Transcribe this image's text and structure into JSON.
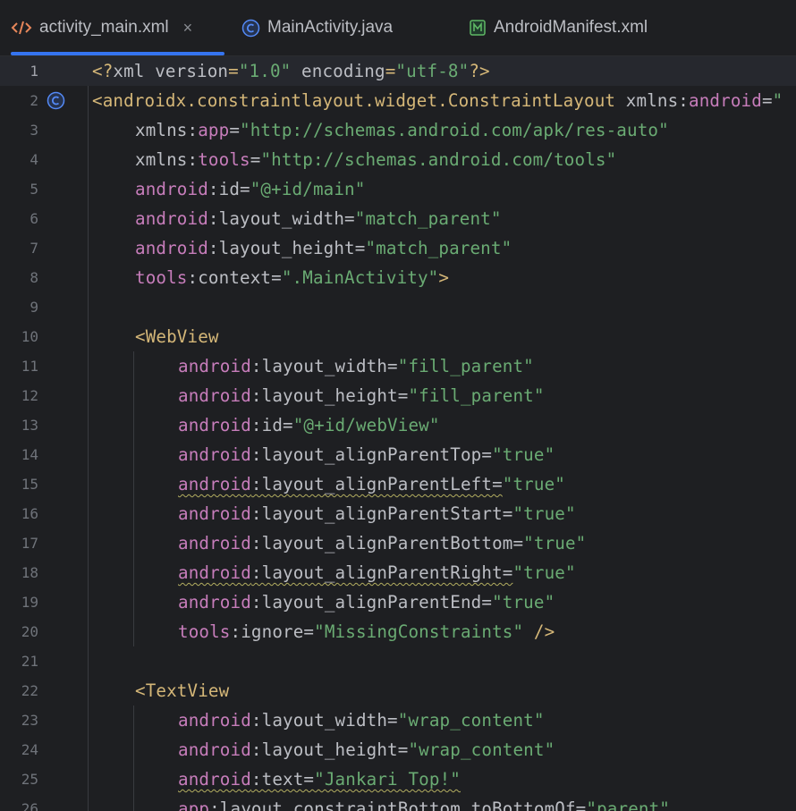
{
  "tabs": [
    {
      "label": "activity_main.xml",
      "icon": "xml-code-icon",
      "active": true,
      "closable": true,
      "close": "×"
    },
    {
      "label": "MainActivity.java",
      "icon": "class-c-icon",
      "active": false
    },
    {
      "label": "AndroidManifest.xml",
      "icon": "manifest-m-icon",
      "active": false
    }
  ],
  "colors": {
    "background": "#1e1f22",
    "tag": "#d5b778",
    "namespace": "#c77dbb",
    "string": "#6aab73",
    "text": "#bcbec4",
    "line_number": "#6f737a",
    "accent": "#3574f0"
  },
  "editor": {
    "current_line": 1,
    "lines": [
      {
        "n": "1",
        "tokens": [
          [
            "punct",
            "<?"
          ],
          [
            "plain",
            "xml version"
          ],
          [
            "punct",
            "="
          ],
          [
            "str",
            "\"1.0\""
          ],
          [
            "plain",
            " encoding"
          ],
          [
            "punct",
            "="
          ],
          [
            "str",
            "\"utf-8\""
          ],
          [
            "punct",
            "?>"
          ]
        ]
      },
      {
        "n": "2",
        "gutter_icon": "class-c-icon",
        "tokens": [
          [
            "tag",
            "<androidx.constraintlayout.widget.ConstraintLayout"
          ],
          [
            "plain",
            " xmlns:"
          ],
          [
            "ns",
            "android"
          ],
          [
            "plain",
            "="
          ],
          [
            "str",
            "\""
          ]
        ]
      },
      {
        "n": "3",
        "indent": 1,
        "tokens": [
          [
            "plain",
            "xmlns:"
          ],
          [
            "ns",
            "app"
          ],
          [
            "plain",
            "="
          ],
          [
            "str",
            "\"http://schemas.android.com/apk/res-auto\""
          ]
        ]
      },
      {
        "n": "4",
        "indent": 1,
        "tokens": [
          [
            "plain",
            "xmlns:"
          ],
          [
            "ns",
            "tools"
          ],
          [
            "plain",
            "="
          ],
          [
            "str",
            "\"http://schemas.android.com/tools\""
          ]
        ]
      },
      {
        "n": "5",
        "indent": 1,
        "tokens": [
          [
            "ns",
            "android"
          ],
          [
            "plain",
            ":id="
          ],
          [
            "str",
            "\"@+id/main\""
          ]
        ]
      },
      {
        "n": "6",
        "indent": 1,
        "tokens": [
          [
            "ns",
            "android"
          ],
          [
            "plain",
            ":layout_width="
          ],
          [
            "str",
            "\"match_parent\""
          ]
        ]
      },
      {
        "n": "7",
        "indent": 1,
        "tokens": [
          [
            "ns",
            "android"
          ],
          [
            "plain",
            ":layout_height="
          ],
          [
            "str",
            "\"match_parent\""
          ]
        ]
      },
      {
        "n": "8",
        "indent": 1,
        "tokens": [
          [
            "ns",
            "tools"
          ],
          [
            "plain",
            ":context="
          ],
          [
            "str",
            "\".MainActivity\""
          ],
          [
            "tag",
            ">"
          ]
        ]
      },
      {
        "n": "9",
        "tokens": []
      },
      {
        "n": "10",
        "indent": 1,
        "tokens": [
          [
            "tag",
            "<WebView"
          ]
        ]
      },
      {
        "n": "11",
        "indent": 2,
        "tokens": [
          [
            "ns",
            "android"
          ],
          [
            "plain",
            ":layout_width="
          ],
          [
            "str",
            "\"fill_parent\""
          ]
        ]
      },
      {
        "n": "12",
        "indent": 2,
        "tokens": [
          [
            "ns",
            "android"
          ],
          [
            "plain",
            ":layout_height="
          ],
          [
            "str",
            "\"fill_parent\""
          ]
        ]
      },
      {
        "n": "13",
        "indent": 2,
        "tokens": [
          [
            "ns",
            "android"
          ],
          [
            "plain",
            ":id="
          ],
          [
            "str",
            "\"@+id/webView\""
          ]
        ]
      },
      {
        "n": "14",
        "indent": 2,
        "tokens": [
          [
            "ns",
            "android"
          ],
          [
            "plain",
            ":layout_alignParentTop="
          ],
          [
            "str",
            "\"true\""
          ]
        ]
      },
      {
        "n": "15",
        "indent": 2,
        "warn": true,
        "tokens": [
          [
            "ns",
            "android"
          ],
          [
            "plain",
            ":layout_alignParentLeft="
          ],
          [
            "str",
            "\"true\""
          ]
        ]
      },
      {
        "n": "16",
        "indent": 2,
        "tokens": [
          [
            "ns",
            "android"
          ],
          [
            "plain",
            ":layout_alignParentStart="
          ],
          [
            "str",
            "\"true\""
          ]
        ]
      },
      {
        "n": "17",
        "indent": 2,
        "tokens": [
          [
            "ns",
            "android"
          ],
          [
            "plain",
            ":layout_alignParentBottom="
          ],
          [
            "str",
            "\"true\""
          ]
        ]
      },
      {
        "n": "18",
        "indent": 2,
        "warn": true,
        "tokens": [
          [
            "ns",
            "android"
          ],
          [
            "plain",
            ":layout_alignParentRight="
          ],
          [
            "str",
            "\"true\""
          ]
        ]
      },
      {
        "n": "19",
        "indent": 2,
        "tokens": [
          [
            "ns",
            "android"
          ],
          [
            "plain",
            ":layout_alignParentEnd="
          ],
          [
            "str",
            "\"true\""
          ]
        ]
      },
      {
        "n": "20",
        "indent": 2,
        "tokens": [
          [
            "ns",
            "tools"
          ],
          [
            "plain",
            ":ignore="
          ],
          [
            "str",
            "\"MissingConstraints\""
          ],
          [
            "tag",
            " />"
          ]
        ]
      },
      {
        "n": "21",
        "tokens": []
      },
      {
        "n": "22",
        "indent": 1,
        "tokens": [
          [
            "tag",
            "<TextView"
          ]
        ]
      },
      {
        "n": "23",
        "indent": 2,
        "tokens": [
          [
            "ns",
            "android"
          ],
          [
            "plain",
            ":layout_width="
          ],
          [
            "str",
            "\"wrap_content\""
          ]
        ]
      },
      {
        "n": "24",
        "indent": 2,
        "tokens": [
          [
            "ns",
            "android"
          ],
          [
            "plain",
            ":layout_height="
          ],
          [
            "str",
            "\"wrap_content\""
          ]
        ]
      },
      {
        "n": "25",
        "indent": 2,
        "warn": true,
        "tokens": [
          [
            "ns",
            "android"
          ],
          [
            "plain",
            ":text="
          ],
          [
            "str",
            "\"Jankari Top!\""
          ]
        ]
      },
      {
        "n": "26",
        "indent": 2,
        "tokens": [
          [
            "ns",
            "app"
          ],
          [
            "plain",
            ":layout_constraintBottom_toBottomOf="
          ],
          [
            "str",
            "\"parent\""
          ]
        ]
      }
    ]
  }
}
